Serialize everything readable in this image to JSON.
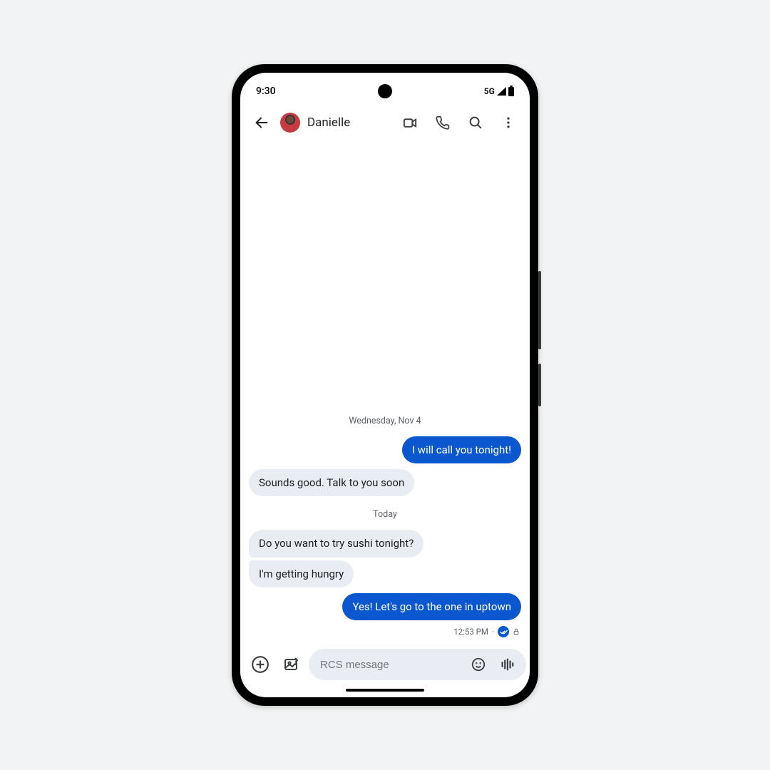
{
  "status_bar": {
    "time": "9:30",
    "network": "5G"
  },
  "app_bar": {
    "contact_name": "Danielle"
  },
  "conversation": {
    "separators": {
      "sep1": "Wednesday, Nov 4",
      "sep2": "Today"
    },
    "messages": {
      "m1": "I will call you tonight!",
      "m2": "Sounds good. Talk to you soon",
      "m3": "Do you want to try sushi tonight?",
      "m4": "I'm getting hungry",
      "m5": "Yes! Let's go to the one in uptown"
    },
    "last_meta_time": "12:53 PM"
  },
  "composer": {
    "placeholder": "RCS message"
  }
}
